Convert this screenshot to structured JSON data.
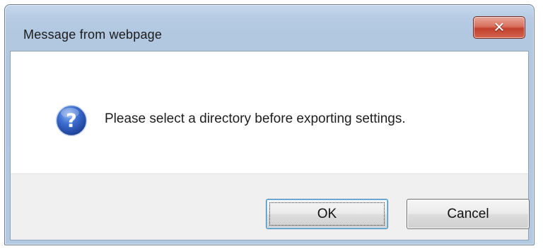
{
  "dialog": {
    "title": "Message from webpage",
    "close_icon": "close-icon",
    "icon": "question-icon",
    "message": "Please select a directory before exporting settings.",
    "ok_label": "OK",
    "cancel_label": "Cancel"
  },
  "colors": {
    "frame": "#b6cbe3",
    "close_button": "#c2402b",
    "icon_blue": "#2a58b8",
    "button_area": "#f0f0f0"
  }
}
